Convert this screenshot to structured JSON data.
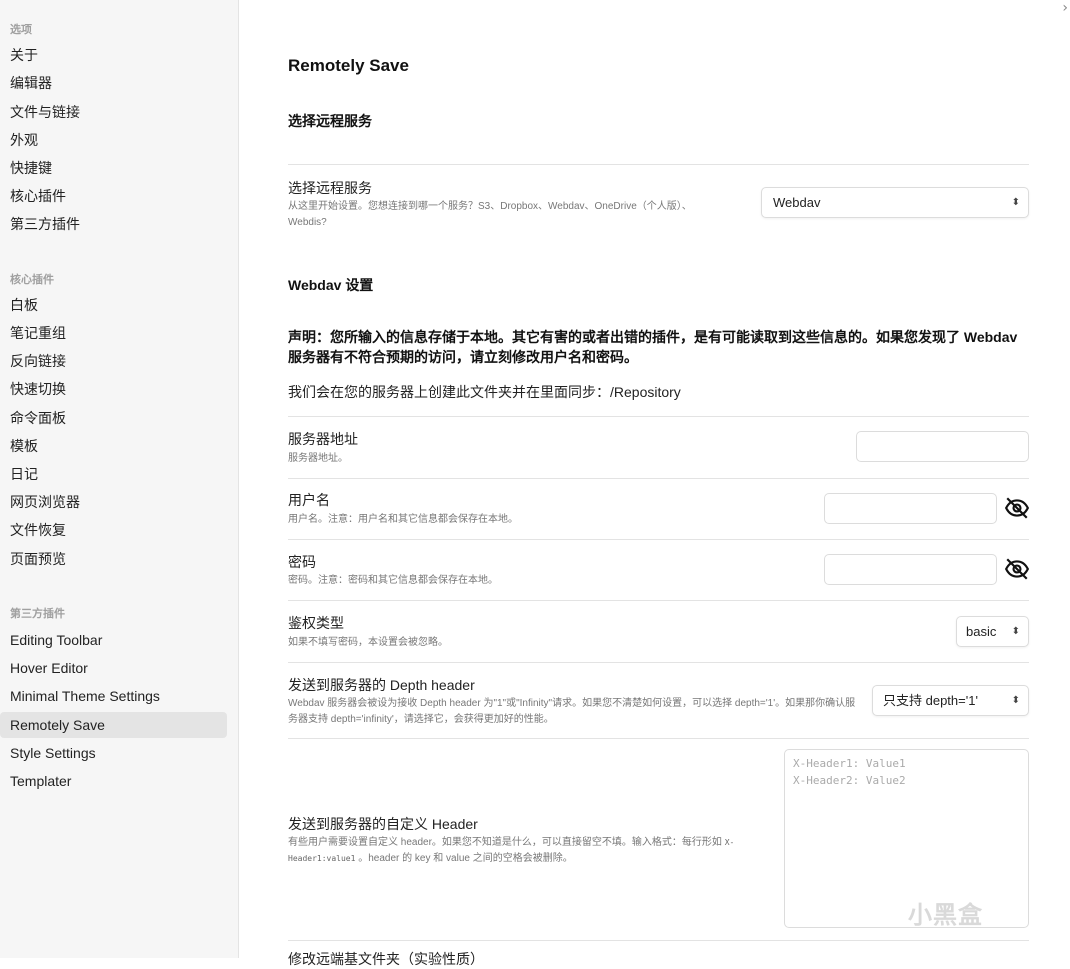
{
  "sidebar": {
    "sections": [
      {
        "heading": "选项",
        "items": [
          "关于",
          "编辑器",
          "文件与链接",
          "外观",
          "快捷键",
          "核心插件",
          "第三方插件"
        ]
      },
      {
        "heading": "核心插件",
        "items": [
          "白板",
          "笔记重组",
          "反向链接",
          "快速切换",
          "命令面板",
          "模板",
          "日记",
          "网页浏览器",
          "文件恢复",
          "页面预览"
        ]
      },
      {
        "heading": "第三方插件",
        "items": [
          "Editing Toolbar",
          "Hover Editor",
          "Minimal Theme Settings",
          "Remotely Save",
          "Style Settings",
          "Templater"
        ]
      }
    ],
    "active_item": "Remotely Save"
  },
  "window": {
    "close_glyph": "›"
  },
  "main": {
    "title": "Remotely Save",
    "section_remote": "选择远程服务",
    "remote_service": {
      "name": "选择远程服务",
      "desc": "从这里开始设置。您想连接到哪一个服务？S3、Dropbox、Webdav、OneDrive（个人版）、Webdis?",
      "selected": "Webdav"
    },
    "section_webdav": "Webdav 设置",
    "warning": "声明：您所输入的信息存储于本地。其它有害的或者出错的插件，是有可能读取到这些信息的。如果您发现了 Webdav 服务器有不符合预期的访问，请立刻修改用户名和密码。",
    "folder_note": "我们会在您的服务器上创建此文件夹并在里面同步：/Repository",
    "server_address": {
      "name": "服务器地址",
      "desc": "服务器地址。",
      "value": ""
    },
    "username": {
      "name": "用户名",
      "desc": "用户名。注意：用户名和其它信息都会保存在本地。",
      "value": ""
    },
    "password": {
      "name": "密码",
      "desc": "密码。注意：密码和其它信息都会保存在本地。",
      "value": ""
    },
    "auth_type": {
      "name": "鉴权类型",
      "desc": "如果不填写密码，本设置会被忽略。",
      "selected": "basic"
    },
    "depth_header": {
      "name": "发送到服务器的 Depth header",
      "desc": "Webdav 服务器会被设为接收 Depth header 为\"1\"或\"Infinity\"请求。如果您不清楚如何设置，可以选择 depth='1'。如果那你确认服务器支持 depth='infinity'，请选择它，会获得更加好的性能。",
      "selected": "只支持 depth='1'"
    },
    "custom_header": {
      "name": "发送到服务器的自定义 Header",
      "desc_before": "有些用户需要设置自定义 header。如果您不知道是什么，可以直接留空不填。输入格式：每行形如",
      "desc_code": "X-Header1:value1",
      "desc_after": "。header 的 key 和 value 之间的空格会被删除。",
      "placeholder": "X-Header1: Value1\nX-Header2: Value2",
      "value": ""
    },
    "next_setting_partial": "修改远端基文件夹（实验性质）",
    "watermark": "小黑盒"
  },
  "icons": {
    "eye_off": "eye-off-icon",
    "chevron": "chevron-up-down-icon"
  }
}
